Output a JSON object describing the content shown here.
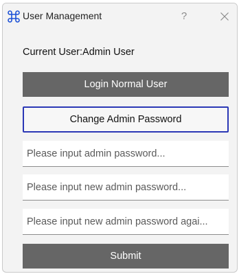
{
  "window": {
    "title": "User Management",
    "help_label": "?"
  },
  "main": {
    "current_user_text": "Current User:Admin User",
    "login_normal_user_label": "Login Normal User",
    "change_admin_password_label": "Change Admin Password",
    "admin_password_placeholder": "Please input admin password...",
    "new_password_placeholder": "Please input new admin password...",
    "confirm_password_placeholder": "Please input new admin password agai...",
    "submit_label": "Submit"
  },
  "colors": {
    "accent_border": "#2a37b5",
    "button_gray": "#666666",
    "icon_blue": "#1a4fd6"
  },
  "icons": {
    "app": "command-icon",
    "close": "close-icon"
  }
}
